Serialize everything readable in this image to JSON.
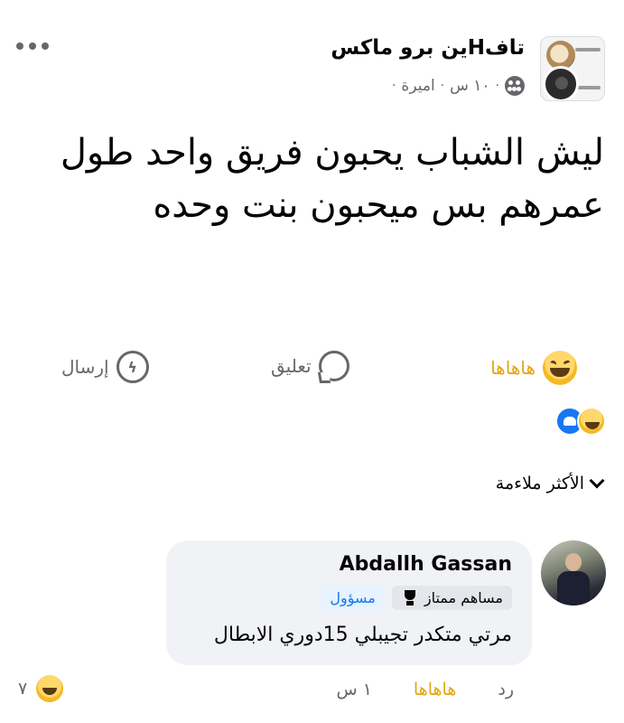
{
  "post": {
    "page_name": "تافHين برو ماكس",
    "author": "اميرة",
    "time": "١٠ س",
    "separator": "·",
    "text_line1": "ليش الشباب يحبون فريق واحد طول",
    "text_line2": "عمرهم بس ميحبون بنت وحده"
  },
  "actions": {
    "react_label": "هاهاها",
    "comment_label": "تعليق",
    "send_label": "إرسال"
  },
  "filter": {
    "label": "الأكثر ملاءمة"
  },
  "comment": {
    "name": "Abdallh Gassan",
    "badge_admin": "مسؤول",
    "badge_top": "مساهم ممتاز",
    "text": "مرتي متكدر تجيبلي 15دوري الابطال",
    "time": "١ س",
    "react_label": "هاهاها",
    "reply_label": "رد",
    "reaction_count": "٧"
  },
  "icons": {
    "more": "more-dots-icon",
    "audience": "globe-icon",
    "react": "laugh-emoji-icon",
    "comment": "comment-bubble-icon",
    "send": "messenger-icon"
  },
  "colors": {
    "haha": "#e3a512",
    "admin_badge_text": "#1877f2",
    "muted_text": "#65676b",
    "bubble_bg": "#f0f2f5"
  }
}
